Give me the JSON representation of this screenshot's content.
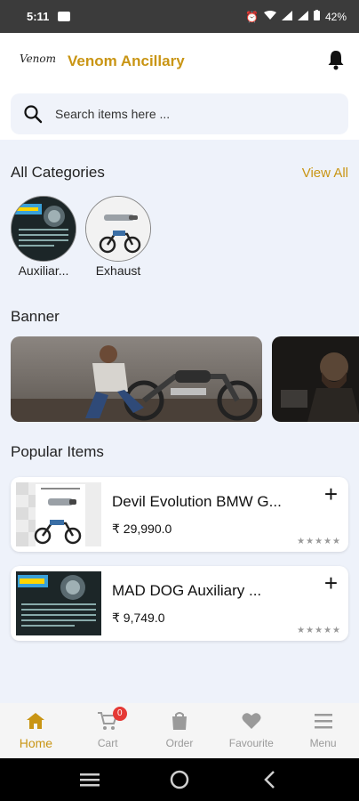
{
  "status_bar": {
    "time": "5:11",
    "battery": "42%"
  },
  "header": {
    "logo_text": "Venom",
    "app_title": "Venom Ancillary"
  },
  "search": {
    "placeholder": "Search items here ..."
  },
  "categories": {
    "title": "All Categories",
    "view_all": "View All",
    "items": [
      {
        "label": "Auxiliar..."
      },
      {
        "label": "Exhaust"
      }
    ]
  },
  "banner": {
    "title": "Banner"
  },
  "popular": {
    "title": "Popular Items",
    "items": [
      {
        "name": "Devil Evolution BMW G...",
        "price": "₹ 29,990.0",
        "rating": "★★★★★"
      },
      {
        "name": "MAD DOG Auxiliary ...",
        "price": "₹ 9,749.0",
        "rating": "★★★★★"
      }
    ]
  },
  "bottom_nav": {
    "items": [
      {
        "label": "Home",
        "icon": "home-icon"
      },
      {
        "label": "Cart",
        "icon": "cart-icon",
        "badge": "0"
      },
      {
        "label": "Order",
        "icon": "bag-icon"
      },
      {
        "label": "Favourite",
        "icon": "heart-icon"
      },
      {
        "label": "Menu",
        "icon": "menu-icon"
      }
    ]
  },
  "colors": {
    "accent": "#c99514",
    "background": "#eef2fa",
    "badge": "#e53935",
    "inactive": "#9a9a9a"
  }
}
